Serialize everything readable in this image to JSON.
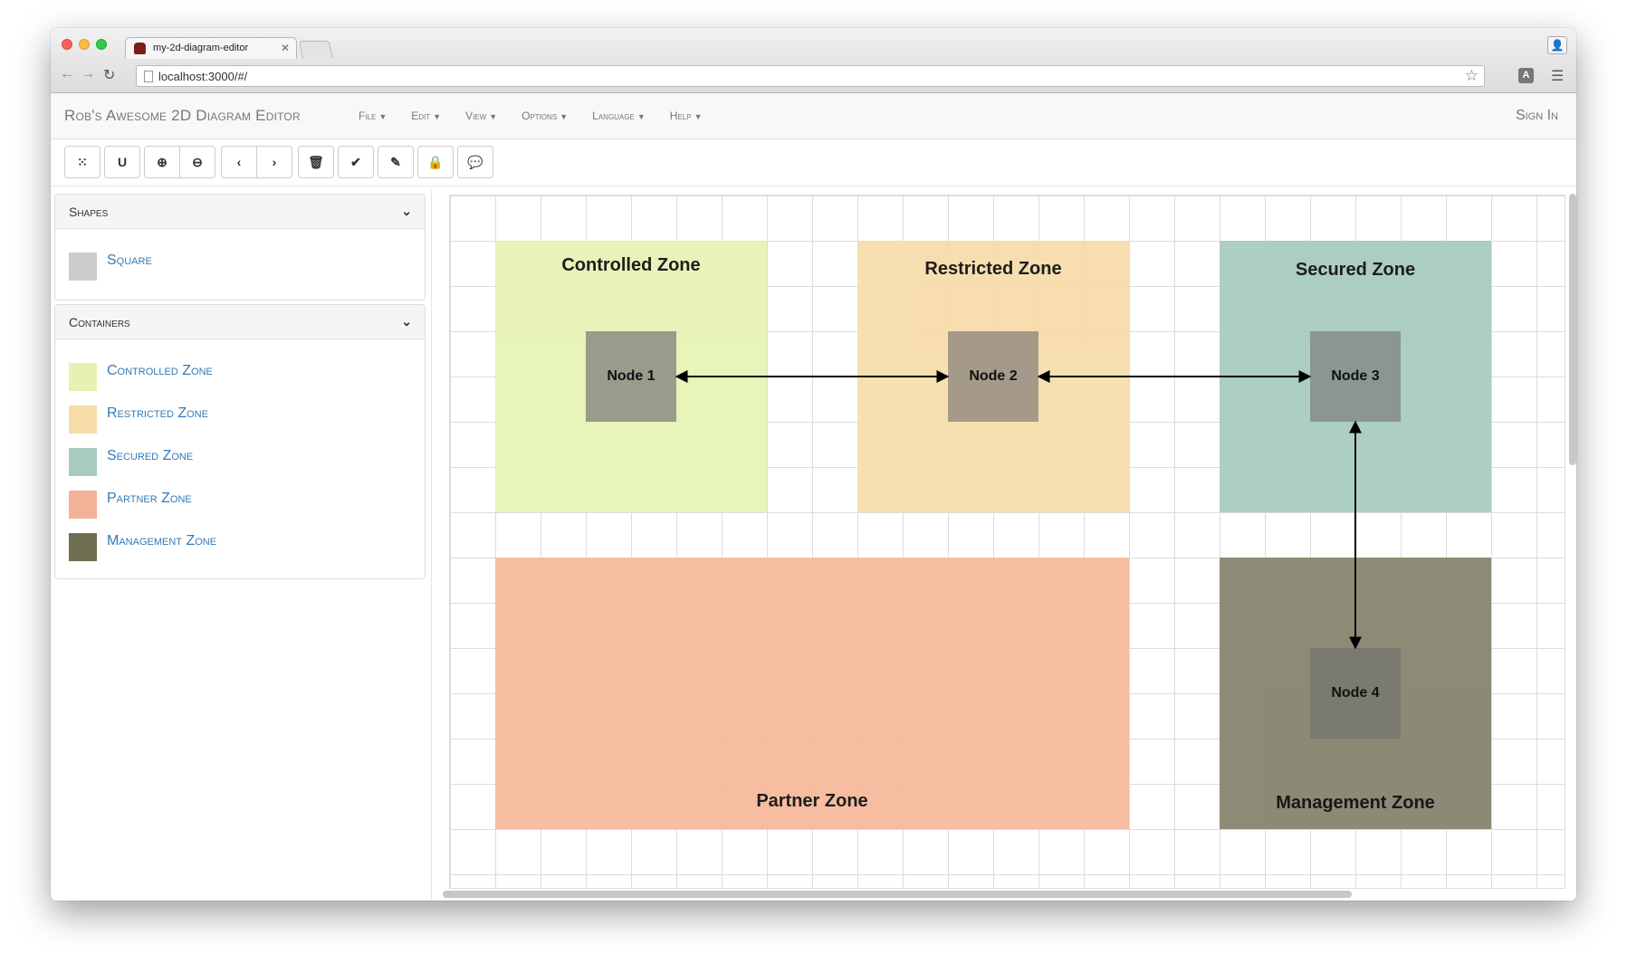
{
  "browser": {
    "tab_title": "my-2d-diagram-editor",
    "url": "localhost:3000/#/"
  },
  "navbar": {
    "brand": "Rob's Awesome 2D Diagram Editor",
    "menus": [
      "File",
      "Edit",
      "View",
      "Options",
      "Language",
      "Help"
    ],
    "sign_in": "Sign In"
  },
  "toolbar": {
    "buttons": [
      "grid",
      "magnet",
      "zoom-in",
      "zoom-out",
      "previous",
      "next",
      "trash",
      "check",
      "pencil",
      "lock",
      "comment"
    ]
  },
  "sidebar": {
    "shapes": {
      "title": "Shapes",
      "items": [
        {
          "label": "Square",
          "color": "#cccccc"
        }
      ]
    },
    "containers": {
      "title": "Containers",
      "items": [
        {
          "label": "Controlled Zone",
          "color": "#e6f2b4"
        },
        {
          "label": "Restricted Zone",
          "color": "#f5dca8"
        },
        {
          "label": "Secured Zone",
          "color": "#a8cbc0"
        },
        {
          "label": "Partner Zone",
          "color": "#f4b398"
        },
        {
          "label": "Management Zone",
          "color": "#6f6e50"
        }
      ]
    }
  },
  "diagram": {
    "zones": [
      {
        "label": "Controlled Zone",
        "color": "#e6f3b6"
      },
      {
        "label": "Restricted Zone",
        "color": "#f8ddab"
      },
      {
        "label": "Secured Zone",
        "color": "#a8cbc1"
      },
      {
        "label": "Partner Zone",
        "color": "#f7ba9d"
      },
      {
        "label": "Management Zone",
        "color": "#898772"
      }
    ],
    "nodes": [
      {
        "label": "Node 1",
        "color": "#9b9b8c"
      },
      {
        "label": "Node 2",
        "color": "#a59a89"
      },
      {
        "label": "Node 3",
        "color": "#8b9690"
      },
      {
        "label": "Node 4",
        "color": "#7a7a70"
      }
    ],
    "edges": [
      {
        "from": "Node 1",
        "to": "Node 2"
      },
      {
        "from": "Node 2",
        "to": "Node 3"
      },
      {
        "from": "Node 3",
        "to": "Node 4"
      }
    ]
  }
}
